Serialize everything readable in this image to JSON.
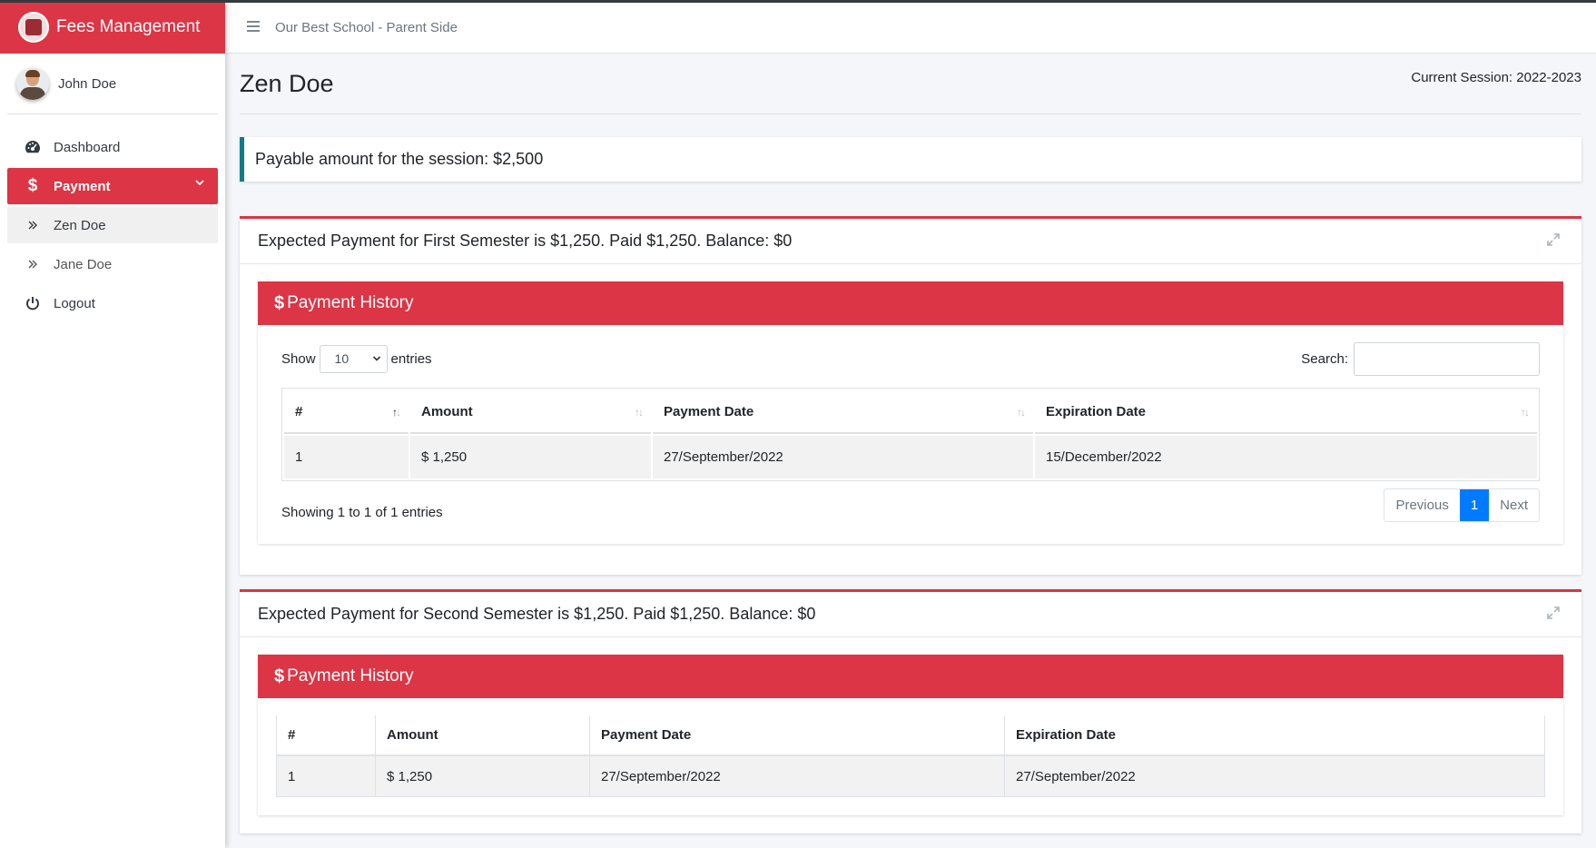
{
  "app": {
    "brand": "Fees Management",
    "school": "Our Best School - Parent Side"
  },
  "user": {
    "name": "John Doe"
  },
  "sidebar": {
    "items": [
      {
        "label": "Dashboard",
        "icon": "dashboard-icon"
      },
      {
        "label": "Payment",
        "icon": "dollar-icon"
      },
      {
        "label": "Zen Doe",
        "icon": "double-chevron-right-icon"
      },
      {
        "label": "Jane Doe",
        "icon": "double-chevron-right-icon"
      },
      {
        "label": "Logout",
        "icon": "power-icon"
      }
    ]
  },
  "page": {
    "title": "Zen Doe",
    "session": "Current Session: 2022-2023",
    "payable": "Payable amount for the session: $2,500"
  },
  "semesters": [
    {
      "title": "Expected Payment for First Semester is $1,250. Paid $1,250. Balance: $0",
      "history_title": "Payment History",
      "show_label": "Show",
      "entries_value": "10",
      "entries_label": "entries",
      "search_label": "Search:",
      "columns": [
        "#",
        "Amount",
        "Payment Date",
        "Expiration Date"
      ],
      "rows": [
        [
          "1",
          "$ 1,250",
          "27/September/2022",
          "15/December/2022"
        ]
      ],
      "info": "Showing 1 to 1 of 1 entries",
      "pager": {
        "prev": "Previous",
        "page": "1",
        "next": "Next"
      }
    },
    {
      "title": "Expected Payment for Second Semester is $1,250. Paid $1,250. Balance: $0",
      "history_title": "Payment History",
      "columns": [
        "#",
        "Amount",
        "Payment Date",
        "Expiration Date"
      ],
      "rows": [
        [
          "1",
          "$ 1,250",
          "27/September/2022",
          "27/September/2022"
        ]
      ]
    }
  ],
  "colors": {
    "accent": "#dc3545",
    "callout": "#117a8b",
    "page_active": "#007bff"
  }
}
